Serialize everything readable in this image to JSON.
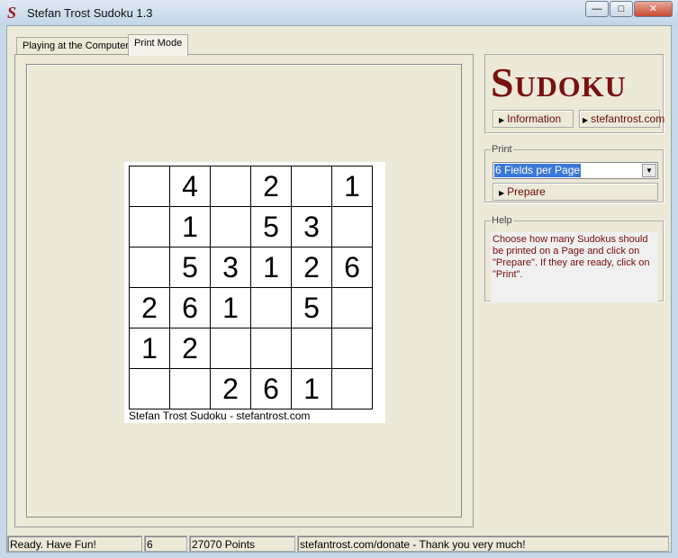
{
  "window": {
    "title": "Stefan Trost Sudoku 1.3",
    "icon": "sudoku-s-logo",
    "buttons": [
      "minimize",
      "maximize",
      "close"
    ]
  },
  "tabs": [
    {
      "label": "Playing at the Computer",
      "active": false
    },
    {
      "label": "Print Mode",
      "active": true
    }
  ],
  "preview": {
    "grid": [
      [
        "",
        "4",
        "",
        "2",
        "",
        "1"
      ],
      [
        "",
        "1",
        "",
        "5",
        "3",
        ""
      ],
      [
        "",
        "5",
        "3",
        "1",
        "2",
        "6"
      ],
      [
        "2",
        "6",
        "1",
        "",
        "5",
        ""
      ],
      [
        "1",
        "2",
        "",
        "",
        "",
        ""
      ],
      [
        "",
        "",
        "2",
        "6",
        "1",
        ""
      ]
    ],
    "caption": "Stefan Trost Sudoku - stefantrost.com"
  },
  "sidebar": {
    "logo": "Sudoku",
    "information_label": "Information",
    "website_label": "stefantrost.com",
    "print": {
      "legend": "Print",
      "select_value": "6 Fields per Page",
      "prepare_label": "Prepare"
    },
    "help": {
      "legend": "Help",
      "text": "Choose how many Sudokus should be printed on a Page and click on \"Prepare\". If they are ready, click on \"Print\"."
    }
  },
  "status": {
    "message": "Ready. Have Fun!",
    "size": "6",
    "points": "27070 Points",
    "donate": "stefantrost.com/donate - Thank you very much!"
  },
  "colors": {
    "accent": "#7a1010",
    "background": "#ece9d8",
    "selection": "#3a78d8"
  }
}
